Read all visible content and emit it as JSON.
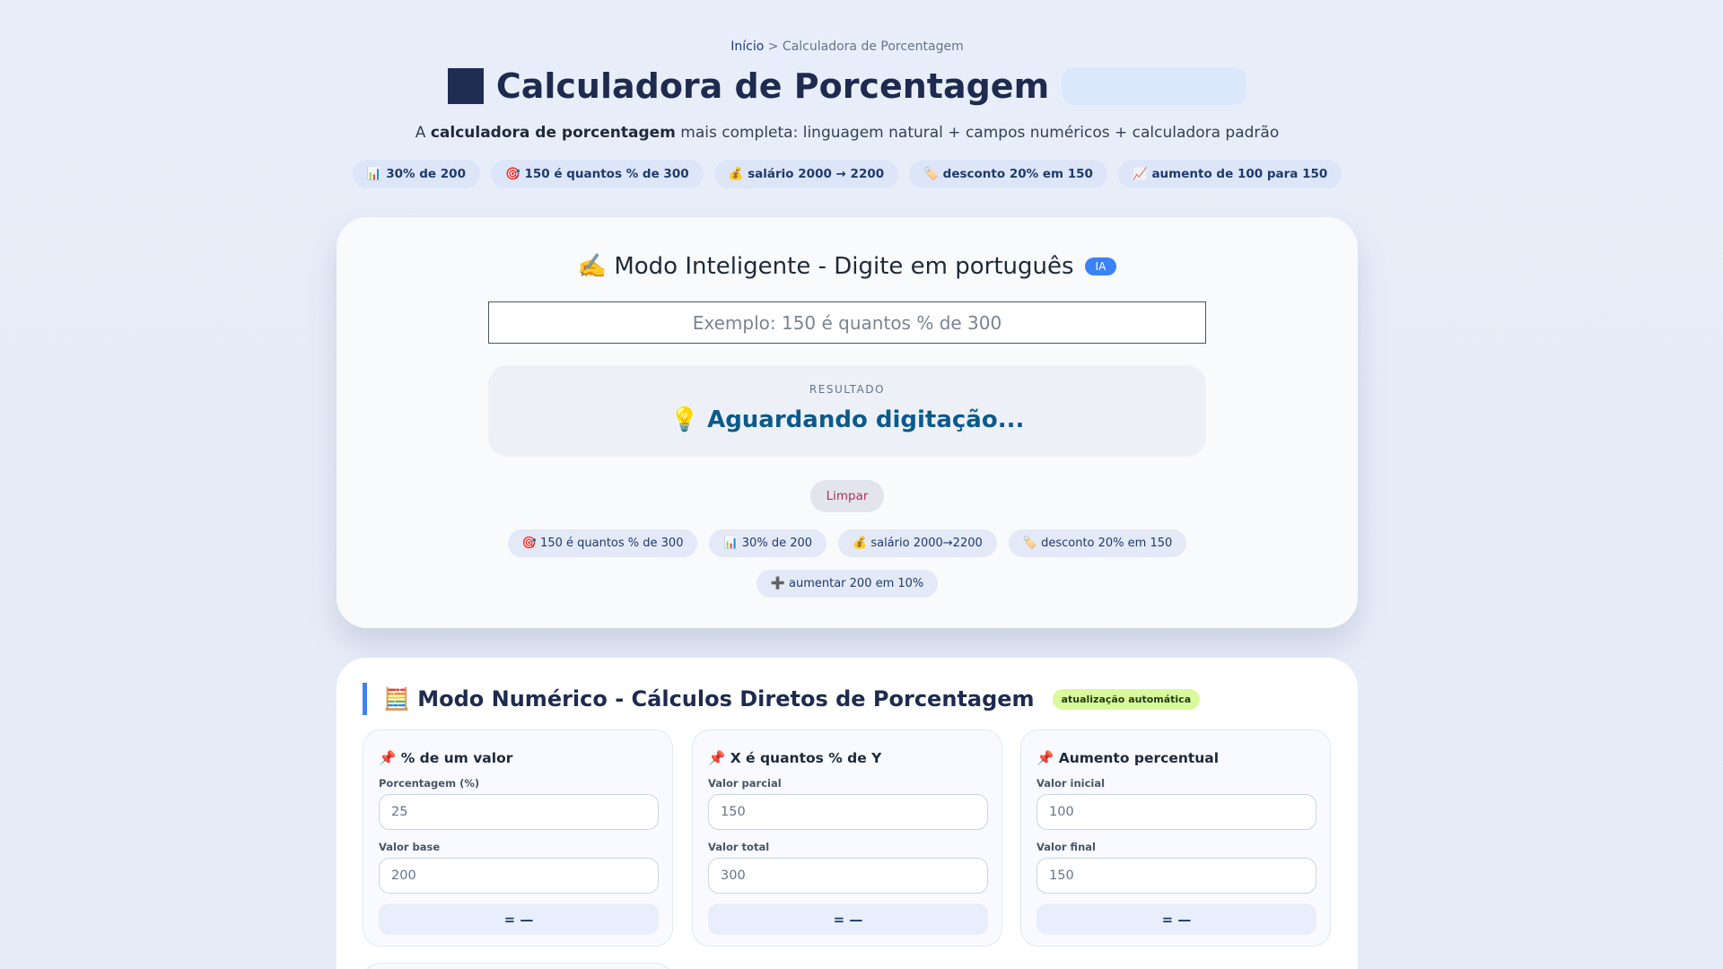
{
  "breadcrumb": {
    "home": "Início",
    "separator": " > ",
    "current": "Calculadora de Porcentagem"
  },
  "header": {
    "title": "Calculadora de Porcentagem",
    "subtitle_pre": "A ",
    "subtitle_bold": "calculadora de porcentagem",
    "subtitle_post": " mais completa: linguagem natural + campos numéricos + calculadora padrão"
  },
  "quick_examples": [
    "📊 30% de 200",
    "🎯 150 é quantos % de 300",
    "💰 salário 2000 → 2200",
    "🏷️ desconto 20% em 150",
    "📈 aumento de 100 para 150"
  ],
  "smart_mode": {
    "title": "✍️ Modo Inteligente - Digite em português",
    "badge": "IA",
    "input_placeholder": "Exemplo: 150 é quantos % de 300",
    "input_value": "",
    "result_label": "RESULTADO",
    "result_value": "💡 Aguardando digitação...",
    "clear_label": "Limpar",
    "examples": [
      "🎯 150 é quantos % de 300",
      "📊 30% de 200",
      "💰 salário 2000→2200",
      "🏷️ desconto 20% em 150",
      "➕ aumentar 200 em 10%"
    ]
  },
  "numeric_mode": {
    "title": "🧮 Modo Numérico - Cálculos Diretos de Porcentagem",
    "badge": "atualização automática",
    "calculators": [
      {
        "title": "📌 % de um valor",
        "field1_label": "Porcentagem (%)",
        "field1_placeholder": "25",
        "field2_label": "Valor base",
        "field2_placeholder": "200",
        "result": "= —"
      },
      {
        "title": "📌 X é quantos % de Y",
        "field1_label": "Valor parcial",
        "field1_placeholder": "150",
        "field2_label": "Valor total",
        "field2_placeholder": "300",
        "result": "= —"
      },
      {
        "title": "📌 Aumento percentual",
        "field1_label": "Valor inicial",
        "field1_placeholder": "100",
        "field2_label": "Valor final",
        "field2_placeholder": "150",
        "result": "= —"
      }
    ]
  },
  "colors": {
    "background": "#e8eef9",
    "accent": "#3b82f6",
    "title": "#1e2b4f",
    "result_text": "#0c5a8a",
    "clear_text": "#b82f55",
    "badge_green": "#d9f99d"
  }
}
